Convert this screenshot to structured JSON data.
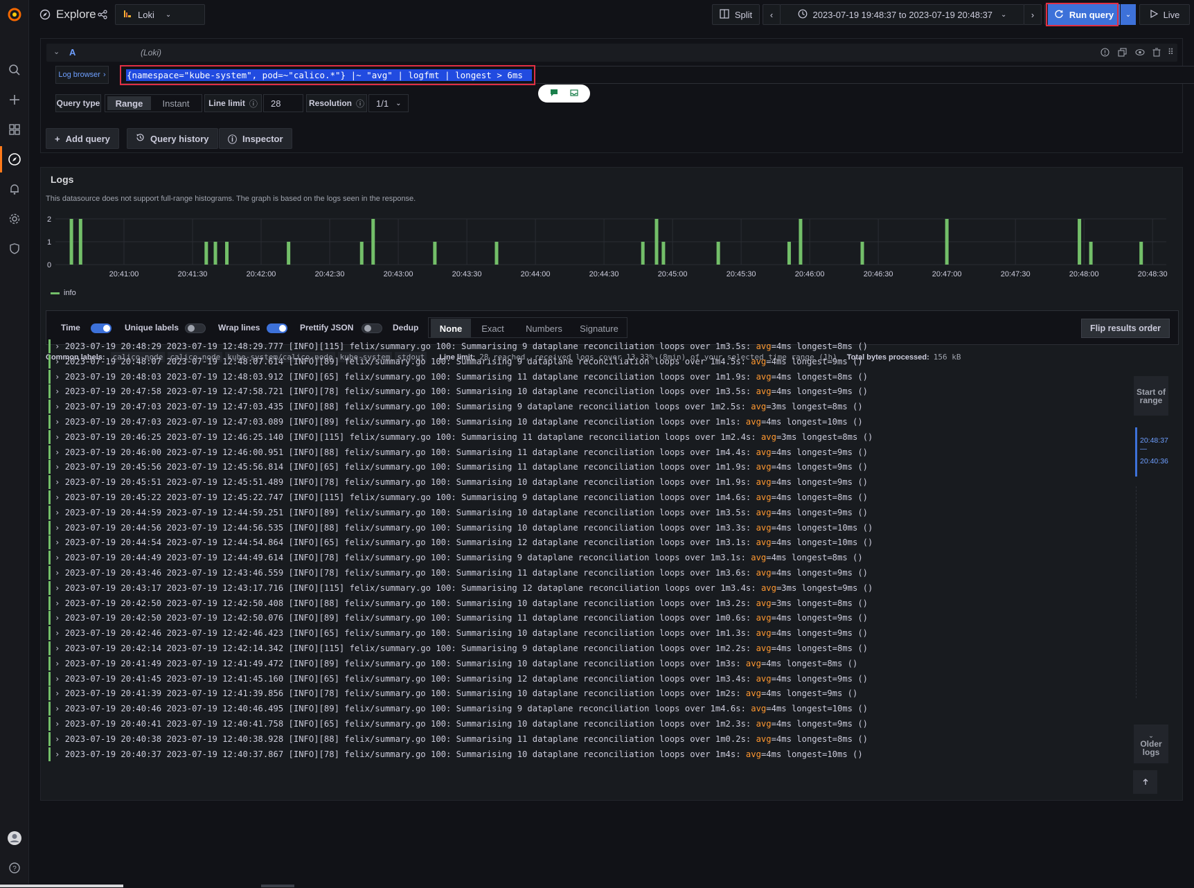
{
  "topbar": {
    "title": "Explore",
    "datasource": "Loki",
    "split_label": "Split",
    "time_range": "2023-07-19 19:48:37 to 2023-07-19 20:48:37",
    "run_query_label": "Run query",
    "live_label": "Live"
  },
  "query": {
    "ref_id": "A",
    "ds_name": "(Loki)",
    "log_browser_label": "Log browser",
    "expression": "{namespace=\"kube-system\", pod=~\"calico.*\"} |~ \"avg\" | logfmt | longest > 6ms",
    "query_type_label": "Query type",
    "type_options": [
      "Range",
      "Instant"
    ],
    "line_limit_label": "Line limit",
    "line_limit_value": "28",
    "resolution_label": "Resolution",
    "resolution_value": "1/1",
    "add_query_label": "Add query",
    "query_history_label": "Query history",
    "inspector_label": "Inspector"
  },
  "logs": {
    "title": "Logs",
    "notice": "This datasource does not support full-range histograms. The graph is based on the logs seen in the response.",
    "legend": "info",
    "options": {
      "time_label": "Time",
      "unique_labels_label": "Unique labels",
      "wrap_lines_label": "Wrap lines",
      "prettify_json_label": "Prettify JSON",
      "dedup_label": "Dedup",
      "dedup_options": [
        "None",
        "Exact",
        "Numbers",
        "Signature"
      ],
      "flip_label": "Flip results order"
    },
    "common_labels_title": "Common labels:",
    "common_labels": [
      "calico-node",
      "calico-node",
      "kube-system/calico-node",
      "kube-system",
      "stdout"
    ],
    "line_limit_title": "Line limit:",
    "line_limit_text": "28 reached, received logs cover 13.33% (8min) of your selected time range (1h)",
    "bytes_title": "Total bytes processed:",
    "bytes_value": "156 kB",
    "nav": {
      "start_label": "Start of range",
      "range_top": "20:48:37",
      "range_dash": "—",
      "range_bottom": "20:40:36",
      "older_label": "Older logs"
    },
    "lines": [
      {
        "ts": "2023-07-19 20:48:29",
        "pre": "2023-07-19 12:48:29.777 [INFO][115] felix/summary.go 100: Summarising 9 dataplane reconciliation loops over 1m3.5s: ",
        "avg": "avg",
        "post": "=4ms longest=8ms ()"
      },
      {
        "ts": "2023-07-19 20:48:07",
        "pre": "2023-07-19 12:48:07.614 [INFO][89] felix/summary.go 100: Summarising 9 dataplane reconciliation loops over 1m4.5s: ",
        "avg": "avg",
        "post": "=4ms longest=9ms ()"
      },
      {
        "ts": "2023-07-19 20:48:03",
        "pre": "2023-07-19 12:48:03.912 [INFO][65] felix/summary.go 100: Summarising 11 dataplane reconciliation loops over 1m1.9s: ",
        "avg": "avg",
        "post": "=4ms longest=8ms ()"
      },
      {
        "ts": "2023-07-19 20:47:58",
        "pre": "2023-07-19 12:47:58.721 [INFO][78] felix/summary.go 100: Summarising 10 dataplane reconciliation loops over 1m3.5s: ",
        "avg": "avg",
        "post": "=4ms longest=9ms ()"
      },
      {
        "ts": "2023-07-19 20:47:03",
        "pre": "2023-07-19 12:47:03.435 [INFO][88] felix/summary.go 100: Summarising 9 dataplane reconciliation loops over 1m2.5s: ",
        "avg": "avg",
        "post": "=3ms longest=8ms ()"
      },
      {
        "ts": "2023-07-19 20:47:03",
        "pre": "2023-07-19 12:47:03.089 [INFO][89] felix/summary.go 100: Summarising 10 dataplane reconciliation loops over 1m1s: ",
        "avg": "avg",
        "post": "=4ms longest=10ms ()"
      },
      {
        "ts": "2023-07-19 20:46:25",
        "pre": "2023-07-19 12:46:25.140 [INFO][115] felix/summary.go 100: Summarising 11 dataplane reconciliation loops over 1m2.4s: ",
        "avg": "avg",
        "post": "=3ms longest=8ms ()"
      },
      {
        "ts": "2023-07-19 20:46:00",
        "pre": "2023-07-19 12:46:00.951 [INFO][88] felix/summary.go 100: Summarising 11 dataplane reconciliation loops over 1m4.4s: ",
        "avg": "avg",
        "post": "=4ms longest=9ms ()"
      },
      {
        "ts": "2023-07-19 20:45:56",
        "pre": "2023-07-19 12:45:56.814 [INFO][65] felix/summary.go 100: Summarising 11 dataplane reconciliation loops over 1m1.9s: ",
        "avg": "avg",
        "post": "=4ms longest=9ms ()"
      },
      {
        "ts": "2023-07-19 20:45:51",
        "pre": "2023-07-19 12:45:51.489 [INFO][78] felix/summary.go 100: Summarising 10 dataplane reconciliation loops over 1m1.9s: ",
        "avg": "avg",
        "post": "=4ms longest=9ms ()"
      },
      {
        "ts": "2023-07-19 20:45:22",
        "pre": "2023-07-19 12:45:22.747 [INFO][115] felix/summary.go 100: Summarising 9 dataplane reconciliation loops over 1m4.6s: ",
        "avg": "avg",
        "post": "=4ms longest=8ms ()"
      },
      {
        "ts": "2023-07-19 20:44:59",
        "pre": "2023-07-19 12:44:59.251 [INFO][89] felix/summary.go 100: Summarising 10 dataplane reconciliation loops over 1m3.5s: ",
        "avg": "avg",
        "post": "=4ms longest=9ms ()"
      },
      {
        "ts": "2023-07-19 20:44:56",
        "pre": "2023-07-19 12:44:56.535 [INFO][88] felix/summary.go 100: Summarising 10 dataplane reconciliation loops over 1m3.3s: ",
        "avg": "avg",
        "post": "=4ms longest=10ms ()"
      },
      {
        "ts": "2023-07-19 20:44:54",
        "pre": "2023-07-19 12:44:54.864 [INFO][65] felix/summary.go 100: Summarising 12 dataplane reconciliation loops over 1m3.1s: ",
        "avg": "avg",
        "post": "=4ms longest=10ms ()"
      },
      {
        "ts": "2023-07-19 20:44:49",
        "pre": "2023-07-19 12:44:49.614 [INFO][78] felix/summary.go 100: Summarising 9 dataplane reconciliation loops over 1m3.1s: ",
        "avg": "avg",
        "post": "=4ms longest=8ms ()"
      },
      {
        "ts": "2023-07-19 20:43:46",
        "pre": "2023-07-19 12:43:46.559 [INFO][78] felix/summary.go 100: Summarising 11 dataplane reconciliation loops over 1m3.6s: ",
        "avg": "avg",
        "post": "=4ms longest=9ms ()"
      },
      {
        "ts": "2023-07-19 20:43:17",
        "pre": "2023-07-19 12:43:17.716 [INFO][115] felix/summary.go 100: Summarising 12 dataplane reconciliation loops over 1m3.4s: ",
        "avg": "avg",
        "post": "=3ms longest=9ms ()"
      },
      {
        "ts": "2023-07-19 20:42:50",
        "pre": "2023-07-19 12:42:50.408 [INFO][88] felix/summary.go 100: Summarising 10 dataplane reconciliation loops over 1m3.2s: ",
        "avg": "avg",
        "post": "=3ms longest=8ms ()"
      },
      {
        "ts": "2023-07-19 20:42:50",
        "pre": "2023-07-19 12:42:50.076 [INFO][89] felix/summary.go 100: Summarising 11 dataplane reconciliation loops over 1m0.6s: ",
        "avg": "avg",
        "post": "=4ms longest=9ms ()"
      },
      {
        "ts": "2023-07-19 20:42:46",
        "pre": "2023-07-19 12:42:46.423 [INFO][65] felix/summary.go 100: Summarising 10 dataplane reconciliation loops over 1m1.3s: ",
        "avg": "avg",
        "post": "=4ms longest=9ms ()"
      },
      {
        "ts": "2023-07-19 20:42:14",
        "pre": "2023-07-19 12:42:14.342 [INFO][115] felix/summary.go 100: Summarising 9 dataplane reconciliation loops over 1m2.2s: ",
        "avg": "avg",
        "post": "=4ms longest=8ms ()"
      },
      {
        "ts": "2023-07-19 20:41:49",
        "pre": "2023-07-19 12:41:49.472 [INFO][89] felix/summary.go 100: Summarising 10 dataplane reconciliation loops over 1m3s: ",
        "avg": "avg",
        "post": "=4ms longest=8ms ()"
      },
      {
        "ts": "2023-07-19 20:41:45",
        "pre": "2023-07-19 12:41:45.160 [INFO][65] felix/summary.go 100: Summarising 12 dataplane reconciliation loops over 1m3.4s: ",
        "avg": "avg",
        "post": "=4ms longest=9ms ()"
      },
      {
        "ts": "2023-07-19 20:41:39",
        "pre": "2023-07-19 12:41:39.856 [INFO][78] felix/summary.go 100: Summarising 10 dataplane reconciliation loops over 1m2s: ",
        "avg": "avg",
        "post": "=4ms longest=9ms ()"
      },
      {
        "ts": "2023-07-19 20:40:46",
        "pre": "2023-07-19 12:40:46.495 [INFO][89] felix/summary.go 100: Summarising 9 dataplane reconciliation loops over 1m4.6s: ",
        "avg": "avg",
        "post": "=4ms longest=10ms ()"
      },
      {
        "ts": "2023-07-19 20:40:41",
        "pre": "2023-07-19 12:40:41.758 [INFO][65] felix/summary.go 100: Summarising 10 dataplane reconciliation loops over 1m2.3s: ",
        "avg": "avg",
        "post": "=4ms longest=9ms ()"
      },
      {
        "ts": "2023-07-19 20:40:38",
        "pre": "2023-07-19 12:40:38.928 [INFO][88] felix/summary.go 100: Summarising 11 dataplane reconciliation loops over 1m0.2s: ",
        "avg": "avg",
        "post": "=4ms longest=8ms ()"
      },
      {
        "ts": "2023-07-19 20:40:37",
        "pre": "2023-07-19 12:40:37.867 [INFO][78] felix/summary.go 100: Summarising 10 dataplane reconciliation loops over 1m4s: ",
        "avg": "avg",
        "post": "=4ms longest=10ms ()"
      }
    ]
  },
  "chart_data": {
    "type": "bar",
    "title": "",
    "xlabel": "",
    "ylabel": "",
    "ylim": [
      0,
      2
    ],
    "y_ticks": [
      "0",
      "1",
      "2"
    ],
    "x_ticks": [
      "20:41:00",
      "20:41:30",
      "20:42:00",
      "20:42:30",
      "20:43:00",
      "20:43:30",
      "20:44:00",
      "20:44:30",
      "20:45:00",
      "20:45:30",
      "20:46:00",
      "20:46:30",
      "20:47:00",
      "20:47:30",
      "20:48:00",
      "20:48:30"
    ],
    "series": [
      {
        "name": "info",
        "color": "#73bf69",
        "bars": [
          {
            "t": "20:40:37",
            "v": 2
          },
          {
            "t": "20:40:41",
            "v": 2
          },
          {
            "t": "20:41:36",
            "v": 1
          },
          {
            "t": "20:41:40",
            "v": 1
          },
          {
            "t": "20:41:45",
            "v": 1
          },
          {
            "t": "20:42:12",
            "v": 1
          },
          {
            "t": "20:42:44",
            "v": 1
          },
          {
            "t": "20:42:49",
            "v": 2
          },
          {
            "t": "20:43:16",
            "v": 1
          },
          {
            "t": "20:43:43",
            "v": 1
          },
          {
            "t": "20:44:47",
            "v": 1
          },
          {
            "t": "20:44:53",
            "v": 2
          },
          {
            "t": "20:44:56",
            "v": 1
          },
          {
            "t": "20:45:20",
            "v": 1
          },
          {
            "t": "20:45:51",
            "v": 1
          },
          {
            "t": "20:45:56",
            "v": 2
          },
          {
            "t": "20:46:23",
            "v": 1
          },
          {
            "t": "20:47:00",
            "v": 2
          },
          {
            "t": "20:47:58",
            "v": 2
          },
          {
            "t": "20:48:03",
            "v": 1
          },
          {
            "t": "20:48:25",
            "v": 1
          }
        ]
      }
    ]
  },
  "colors": {
    "accent": "#3d71d9",
    "highlight": "#e02f44",
    "log_green": "#73bf69",
    "match_orange": "#ff9830"
  }
}
